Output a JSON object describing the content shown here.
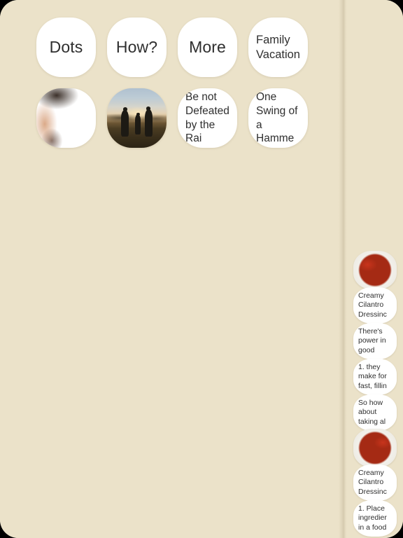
{
  "canvas": {
    "background_color": "#ebe2c9",
    "bubble_color": "#ffffff",
    "text_color": "#2f2f2f"
  },
  "main": {
    "row1": [
      {
        "id": "dots",
        "text": "Dots",
        "type": "text"
      },
      {
        "id": "how",
        "text": "How?",
        "type": "text"
      },
      {
        "id": "more",
        "text": "More",
        "type": "text"
      },
      {
        "id": "family-vacation",
        "text": "Family\nVacation",
        "type": "text"
      }
    ],
    "row2": [
      {
        "id": "photo-rock",
        "text": "",
        "type": "photo",
        "alt": "red rock cliff against blue sky"
      },
      {
        "id": "photo-hikers",
        "text": "",
        "type": "photo",
        "alt": "three people silhouetted on a plain at dusk"
      },
      {
        "id": "be-not-defeated",
        "text": "Be not\nDefeated\nby the Rai",
        "type": "text"
      },
      {
        "id": "one-swing",
        "text": "One\nSwing of\na Hamme",
        "type": "text"
      }
    ]
  },
  "sidebar": {
    "cards": [
      {
        "id": "mini-salad-1",
        "text": "",
        "type": "photo",
        "alt": "salad with creamy cilantro dressing"
      },
      {
        "id": "mini-creamy-1",
        "text": "Creamy\nCilantro\nDressinc",
        "type": "text"
      },
      {
        "id": "mini-theres",
        "text": "There's\npower in\ngood",
        "type": "text"
      },
      {
        "id": "mini-step-1",
        "text": "1.  they\nmake for\nfast, fillin",
        "type": "text"
      },
      {
        "id": "mini-so-how",
        "text": "So how\nabout\ntaking al",
        "type": "text"
      },
      {
        "id": "mini-salad-2",
        "text": "",
        "type": "photo",
        "alt": "salad with creamy cilantro dressing"
      },
      {
        "id": "mini-creamy-2",
        "text": "Creamy\nCilantro\nDressinc",
        "type": "text"
      },
      {
        "id": "mini-place",
        "text": "1.  Place\ningredier\nin a food",
        "type": "text"
      }
    ]
  }
}
